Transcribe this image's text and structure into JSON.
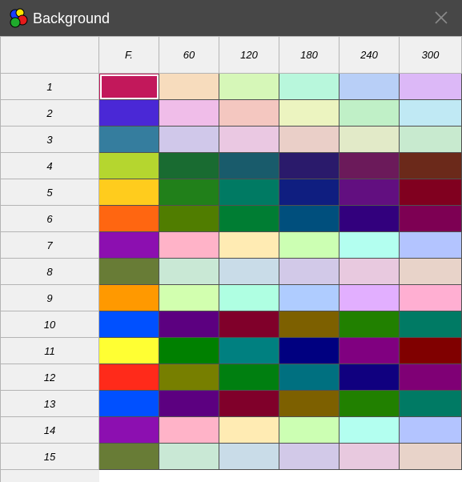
{
  "window": {
    "title": "Background"
  },
  "columns": [
    "F.",
    "60",
    "120",
    "180",
    "240",
    "300"
  ],
  "rows": [
    {
      "label": "1",
      "colors": [
        "#c2185b",
        "#f7dcbd",
        "#d6f7b8",
        "#b8f7dc",
        "#b8cff7",
        "#dcb8f7"
      ]
    },
    {
      "label": "2",
      "colors": [
        "#4a28d6",
        "#f0bde9",
        "#f4c7c0",
        "#ecf4c0",
        "#c0f0c7",
        "#c0e9f4"
      ]
    },
    {
      "label": "3",
      "colors": [
        "#357d9e",
        "#d0c8ea",
        "#eac8e2",
        "#eacfc8",
        "#e2eac8",
        "#c8eacf"
      ]
    },
    {
      "label": "4",
      "colors": [
        "#b5d62f",
        "#196b31",
        "#195b6b",
        "#2a1a6b",
        "#6b1a5a",
        "#6b291a"
      ]
    },
    {
      "label": "5",
      "colors": [
        "#ffcc1d",
        "#21801a",
        "#007a63",
        "#0f1e80",
        "#620f80",
        "#80001f"
      ]
    },
    {
      "label": "6",
      "colors": [
        "#ff6611",
        "#507d00",
        "#007d33",
        "#004f7d",
        "#32007d",
        "#7d0053"
      ]
    },
    {
      "label": "7",
      "colors": [
        "#8c0fb0",
        "#ffb3c8",
        "#ffebb3",
        "#ccffb3",
        "#b3fff0",
        "#b3c4ff"
      ]
    },
    {
      "label": "8",
      "colors": [
        "#687c36",
        "#c9e8d5",
        "#c9dce8",
        "#d2c9e8",
        "#e8c9df",
        "#e8d3c9"
      ]
    },
    {
      "label": "9",
      "colors": [
        "#ff9900",
        "#d2ffaf",
        "#afffe2",
        "#afccff",
        "#e2afff",
        "#ffafd2"
      ]
    },
    {
      "label": "10",
      "colors": [
        "#0050ff",
        "#5c0080",
        "#80002a",
        "#7d6000",
        "#218000",
        "#007a64"
      ]
    },
    {
      "label": "11",
      "colors": [
        "#ffff33",
        "#008000",
        "#008080",
        "#000080",
        "#800080",
        "#800000"
      ]
    },
    {
      "label": "12",
      "colors": [
        "#ff2a1a",
        "#777f00",
        "#007f10",
        "#007080",
        "#10007f",
        "#7f0075"
      ]
    },
    {
      "label": "13",
      "colors": [
        "#0050ff",
        "#5c0080",
        "#80002a",
        "#7d6000",
        "#218000",
        "#007a64"
      ]
    },
    {
      "label": "14",
      "colors": [
        "#8c0fb0",
        "#ffb3c8",
        "#ffebb3",
        "#ccffb3",
        "#b3fff0",
        "#b3c4ff"
      ]
    },
    {
      "label": "15",
      "colors": [
        "#687c36",
        "#c9e8d5",
        "#c9dce8",
        "#d2c9e8",
        "#e8c9df",
        "#e8d3c9"
      ]
    }
  ],
  "selected": {
    "row": 0,
    "col": 0
  },
  "icons": {
    "app": "color-circles-icon",
    "close": "close-icon"
  }
}
